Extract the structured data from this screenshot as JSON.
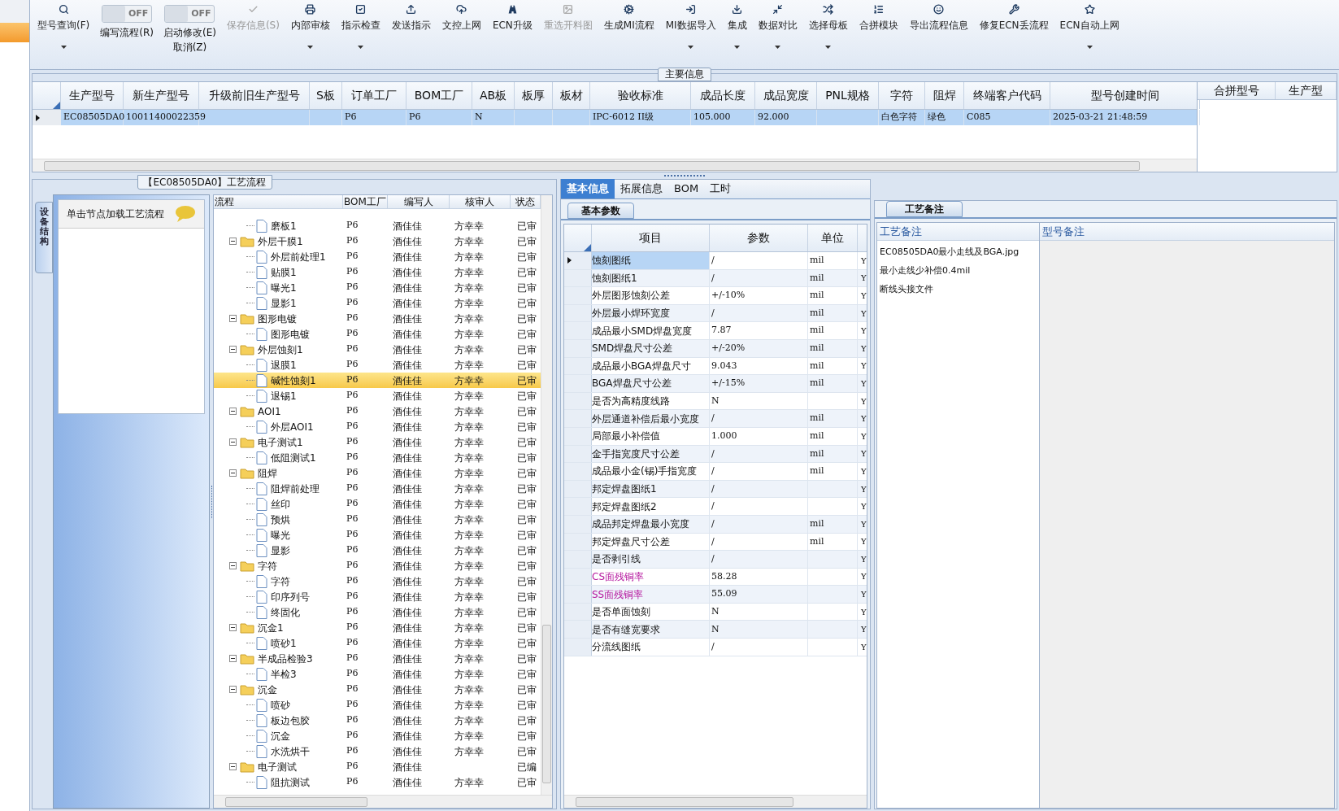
{
  "toolbar": [
    {
      "kind": "button",
      "label": "型号查询(F)",
      "dropdown": true,
      "disabled": false
    },
    {
      "kind": "toggle",
      "label": "编写流程(R)",
      "switch_text": "OFF",
      "on": false
    },
    {
      "kind": "toggle",
      "label": "启动修改(E)",
      "label2": "取消(Z)",
      "switch_text": "OFF",
      "on": false
    },
    {
      "kind": "button",
      "label": "保存信息(S)",
      "dropdown": false,
      "disabled": true
    },
    {
      "kind": "button",
      "label": "内部审核",
      "dropdown": true,
      "disabled": false
    },
    {
      "kind": "button",
      "label": "指示检查",
      "dropdown": true,
      "disabled": false
    },
    {
      "kind": "button",
      "label": "发送指示",
      "dropdown": false,
      "disabled": false
    },
    {
      "kind": "button",
      "label": "文控上网",
      "dropdown": false,
      "disabled": false
    },
    {
      "kind": "button",
      "label": "ECN升级",
      "dropdown": false,
      "disabled": false
    },
    {
      "kind": "button",
      "label": "重选开料图",
      "dropdown": false,
      "disabled": true
    },
    {
      "kind": "button",
      "label": "生成MI流程",
      "dropdown": false,
      "disabled": false
    },
    {
      "kind": "button",
      "label": "MI数据导入",
      "dropdown": true,
      "disabled": false
    },
    {
      "kind": "button",
      "label": "集成",
      "dropdown": true,
      "disabled": false
    },
    {
      "kind": "button",
      "label": "数据对比",
      "dropdown": true,
      "disabled": false
    },
    {
      "kind": "button",
      "label": "选择母板",
      "dropdown": true,
      "disabled": false
    },
    {
      "kind": "button",
      "label": "合拼模块",
      "dropdown": false,
      "disabled": false
    },
    {
      "kind": "button",
      "label": "导出流程信息",
      "dropdown": false,
      "disabled": false
    },
    {
      "kind": "button",
      "label": "修复ECN丢流程",
      "dropdown": false,
      "disabled": false
    },
    {
      "kind": "button",
      "label": "ECN自动上网",
      "dropdown": true,
      "disabled": false
    }
  ],
  "main_info": {
    "title": "主要信息",
    "table": {
      "columns": [
        "生产型号",
        "新生产型号",
        "升级前旧生产型号",
        "S板",
        "订单工厂",
        "BOM工厂",
        "AB板",
        "板厚",
        "板材",
        "验收标准",
        "成品长度",
        "成品宽度",
        "PNL规格",
        "字符",
        "阻焊",
        "终端客户代码",
        "型号创建时间"
      ],
      "rows": [
        {
          "selected": true,
          "cells": [
            "EC08505DA0",
            "10011400022359",
            null,
            null,
            "P6",
            "P6",
            "N",
            null,
            null,
            "IPC-6012 II级",
            "105.000",
            "92.000",
            null,
            "白色字符",
            "绿色",
            "C085",
            "2025-03-21 21:48:59"
          ]
        }
      ]
    },
    "merge_table": {
      "columns": [
        "合拼型号",
        "生产型"
      ]
    }
  },
  "process_panel": {
    "title": "【EC08505DA0】工艺流程",
    "side_tab": "设备结构",
    "hint": "单击节点加载工艺流程",
    "tree": {
      "columns": [
        "流程",
        "BOM工厂",
        "编写人",
        "核审人",
        "状态"
      ],
      "nodes": [
        {
          "kind": "file",
          "label": "磨板1",
          "bom": "P6",
          "writer": "酒佳佳",
          "reviewer": "方幸幸",
          "status": "已审",
          "selected": false
        },
        {
          "kind": "folder",
          "label": "外层干膜1",
          "bom": "P6",
          "writer": "酒佳佳",
          "reviewer": "方幸幸",
          "status": "已审",
          "selected": false,
          "expanded": true,
          "children": [
            {
              "kind": "file",
              "label": "外层前处理1",
              "bom": "P6",
              "writer": "酒佳佳",
              "reviewer": "方幸幸",
              "status": "已审",
              "selected": false
            },
            {
              "kind": "file",
              "label": "贴膜1",
              "bom": "P6",
              "writer": "酒佳佳",
              "reviewer": "方幸幸",
              "status": "已审",
              "selected": false
            },
            {
              "kind": "file",
              "label": "曝光1",
              "bom": "P6",
              "writer": "酒佳佳",
              "reviewer": "方幸幸",
              "status": "已审",
              "selected": false
            },
            {
              "kind": "file",
              "label": "显影1",
              "bom": "P6",
              "writer": "酒佳佳",
              "reviewer": "方幸幸",
              "status": "已审",
              "selected": false
            }
          ]
        },
        {
          "kind": "folder",
          "label": "图形电镀",
          "bom": "P6",
          "writer": "酒佳佳",
          "reviewer": "方幸幸",
          "status": "已审",
          "selected": false,
          "expanded": true,
          "children": [
            {
              "kind": "file",
              "label": "图形电镀",
              "bom": "P6",
              "writer": "酒佳佳",
              "reviewer": "方幸幸",
              "status": "已审",
              "selected": false
            }
          ]
        },
        {
          "kind": "folder",
          "label": "外层蚀刻1",
          "bom": "P6",
          "writer": "酒佳佳",
          "reviewer": "方幸幸",
          "status": "已审",
          "selected": false,
          "expanded": true,
          "children": [
            {
              "kind": "file",
              "label": "退膜1",
              "bom": "P6",
              "writer": "酒佳佳",
              "reviewer": "方幸幸",
              "status": "已审",
              "selected": false
            },
            {
              "kind": "file",
              "label": "碱性蚀刻1",
              "bom": "P6",
              "writer": "酒佳佳",
              "reviewer": "方幸幸",
              "status": "已审",
              "selected": true
            },
            {
              "kind": "file",
              "label": "退锡1",
              "bom": "P6",
              "writer": "酒佳佳",
              "reviewer": "方幸幸",
              "status": "已审",
              "selected": false
            }
          ]
        },
        {
          "kind": "folder",
          "label": "AOI1",
          "bom": "P6",
          "writer": "酒佳佳",
          "reviewer": "方幸幸",
          "status": "已审",
          "selected": false,
          "expanded": true,
          "children": [
            {
              "kind": "file",
              "label": "外层AOI1",
              "bom": "P6",
              "writer": "酒佳佳",
              "reviewer": "方幸幸",
              "status": "已审",
              "selected": false
            }
          ]
        },
        {
          "kind": "folder",
          "label": "电子测试1",
          "bom": "P6",
          "writer": "酒佳佳",
          "reviewer": "方幸幸",
          "status": "已审",
          "selected": false,
          "expanded": true,
          "children": [
            {
              "kind": "file",
              "label": "低阻测试1",
              "bom": "P6",
              "writer": "酒佳佳",
              "reviewer": "方幸幸",
              "status": "已审",
              "selected": false
            }
          ]
        },
        {
          "kind": "folder",
          "label": "阻焊",
          "bom": "P6",
          "writer": "酒佳佳",
          "reviewer": "方幸幸",
          "status": "已审",
          "selected": false,
          "expanded": true,
          "children": [
            {
              "kind": "file",
              "label": "阻焊前处理",
              "bom": "P6",
              "writer": "酒佳佳",
              "reviewer": "方幸幸",
              "status": "已审",
              "selected": false
            },
            {
              "kind": "file",
              "label": "丝印",
              "bom": "P6",
              "writer": "酒佳佳",
              "reviewer": "方幸幸",
              "status": "已审",
              "selected": false
            },
            {
              "kind": "file",
              "label": "预烘",
              "bom": "P6",
              "writer": "酒佳佳",
              "reviewer": "方幸幸",
              "status": "已审",
              "selected": false
            },
            {
              "kind": "file",
              "label": "曝光",
              "bom": "P6",
              "writer": "酒佳佳",
              "reviewer": "方幸幸",
              "status": "已审",
              "selected": false
            },
            {
              "kind": "file",
              "label": "显影",
              "bom": "P6",
              "writer": "酒佳佳",
              "reviewer": "方幸幸",
              "status": "已审",
              "selected": false
            }
          ]
        },
        {
          "kind": "folder",
          "label": "字符",
          "bom": "P6",
          "writer": "酒佳佳",
          "reviewer": "方幸幸",
          "status": "已审",
          "selected": false,
          "expanded": true,
          "children": [
            {
              "kind": "file",
              "label": "字符",
              "bom": "P6",
              "writer": "酒佳佳",
              "reviewer": "方幸幸",
              "status": "已审",
              "selected": false
            },
            {
              "kind": "file",
              "label": "印序列号",
              "bom": "P6",
              "writer": "酒佳佳",
              "reviewer": "方幸幸",
              "status": "已审",
              "selected": false
            },
            {
              "kind": "file",
              "label": "终固化",
              "bom": "P6",
              "writer": "酒佳佳",
              "reviewer": "方幸幸",
              "status": "已审",
              "selected": false
            }
          ]
        },
        {
          "kind": "folder",
          "label": "沉金1",
          "bom": "P6",
          "writer": "酒佳佳",
          "reviewer": "方幸幸",
          "status": "已审",
          "selected": false,
          "expanded": true,
          "children": [
            {
              "kind": "file",
              "label": "喷砂1",
              "bom": "P6",
              "writer": "酒佳佳",
              "reviewer": "方幸幸",
              "status": "已审",
              "selected": false
            }
          ]
        },
        {
          "kind": "folder",
          "label": "半成品检验3",
          "bom": "P6",
          "writer": "酒佳佳",
          "reviewer": "方幸幸",
          "status": "已审",
          "selected": false,
          "expanded": true,
          "children": [
            {
              "kind": "file",
              "label": "半检3",
              "bom": "P6",
              "writer": "酒佳佳",
              "reviewer": "方幸幸",
              "status": "已审",
              "selected": false
            }
          ]
        },
        {
          "kind": "folder",
          "label": "沉金",
          "bom": "P6",
          "writer": "酒佳佳",
          "reviewer": "方幸幸",
          "status": "已审",
          "selected": false,
          "expanded": true,
          "children": [
            {
              "kind": "file",
              "label": "喷砂",
              "bom": "P6",
              "writer": "酒佳佳",
              "reviewer": "方幸幸",
              "status": "已审",
              "selected": false
            },
            {
              "kind": "file",
              "label": "板边包胶",
              "bom": "P6",
              "writer": "酒佳佳",
              "reviewer": "方幸幸",
              "status": "已审",
              "selected": false
            },
            {
              "kind": "file",
              "label": "沉金",
              "bom": "P6",
              "writer": "酒佳佳",
              "reviewer": "方幸幸",
              "status": "已审",
              "selected": false
            },
            {
              "kind": "file",
              "label": "水洗烘干",
              "bom": "P6",
              "writer": "酒佳佳",
              "reviewer": "方幸幸",
              "status": "已审",
              "selected": false
            }
          ]
        },
        {
          "kind": "folder",
          "label": "电子测试",
          "bom": "P6",
          "writer": "酒佳佳",
          "status": "已编",
          "selected": false,
          "expanded": true,
          "children": [
            {
              "kind": "file",
              "label": "阻抗测试",
              "bom": "P6",
              "writer": "酒佳佳",
              "reviewer": "方幸幸",
              "status": "已审",
              "selected": false
            }
          ]
        }
      ]
    }
  },
  "detail_panel": {
    "tabs": [
      {
        "label": "基本信息",
        "selected": true
      },
      {
        "label": "拓展信息",
        "selected": false
      },
      {
        "label": "BOM",
        "selected": false
      },
      {
        "label": "工时",
        "selected": false
      }
    ],
    "subtab": "基本参数",
    "table": {
      "columns": [
        "项目",
        "参数",
        "单位"
      ],
      "rows": [
        {
          "item": "蚀刻图纸",
          "param": "/",
          "unit": "mil",
          "flag": "Y",
          "selected": true
        },
        {
          "item": "蚀刻图纸1",
          "param": "/",
          "unit": "mil",
          "flag": "Y",
          "selected": false
        },
        {
          "item": "外层图形蚀刻公差",
          "param": "+/-10%",
          "unit": "mil",
          "flag": "Y",
          "selected": false
        },
        {
          "item": "外层最小焊环宽度",
          "param": "/",
          "unit": "mil",
          "flag": "Y",
          "selected": false
        },
        {
          "item": "成品最小SMD焊盘宽度",
          "param": "7.87",
          "unit": "mil",
          "flag": "Y",
          "selected": false
        },
        {
          "item": "SMD焊盘尺寸公差",
          "param": "+/-20%",
          "unit": "mil",
          "flag": "Y",
          "selected": false
        },
        {
          "item": "成品最小BGA焊盘尺寸",
          "param": "9.043",
          "unit": "mil",
          "flag": "Y",
          "selected": false
        },
        {
          "item": "BGA焊盘尺寸公差",
          "param": "+/-15%",
          "unit": "mil",
          "flag": "Y",
          "selected": false
        },
        {
          "item": "是否为高精度线路",
          "param": "N",
          "flag": "Y",
          "selected": false
        },
        {
          "item": "外层通道补偿后最小宽度",
          "param": "/",
          "unit": "mil",
          "flag": "Y",
          "selected": false
        },
        {
          "item": "局部最小补偿值",
          "param": "1.000",
          "unit": "mil",
          "flag": "Y",
          "selected": false
        },
        {
          "item": "金手指宽度尺寸公差",
          "param": "/",
          "unit": "mil",
          "flag": "Y",
          "selected": false
        },
        {
          "item": "成品最小金(锡)手指宽度",
          "param": "/",
          "unit": "mil",
          "flag": "Y",
          "selected": false
        },
        {
          "item": "邦定焊盘图纸1",
          "param": "/",
          "flag": "Y",
          "selected": false
        },
        {
          "item": "邦定焊盘图纸2",
          "param": "/",
          "flag": "Y",
          "selected": false
        },
        {
          "item": "成品邦定焊盘最小宽度",
          "param": "/",
          "unit": "mil",
          "flag": "Y",
          "selected": false
        },
        {
          "item": "邦定焊盘尺寸公差",
          "param": "/",
          "unit": "mil",
          "flag": "Y",
          "selected": false
        },
        {
          "item": "是否剥引线",
          "param": "/",
          "flag": "Y",
          "selected": false
        },
        {
          "item": "CS面残铜率",
          "param": "58.28",
          "flag": "Y",
          "selected": false,
          "color": "#b5179e"
        },
        {
          "item": "SS面残铜率",
          "param": "55.09",
          "flag": "Y",
          "selected": false,
          "color": "#b5179e"
        },
        {
          "item": "是否单面蚀刻",
          "param": "N",
          "flag": "Y",
          "selected": false
        },
        {
          "item": "是否有缝宽要求",
          "param": "N",
          "flag": "Y",
          "selected": false
        },
        {
          "item": "分流线图纸",
          "param": "/",
          "flag": "Y",
          "selected": false
        }
      ]
    }
  },
  "notes_panel": {
    "tab": "工艺备注",
    "columns": [
      "工艺备注",
      "型号备注"
    ],
    "notes": [
      "EC08505DA0最小走线及BGA.jpg",
      "最小走线少补偿0.4mil",
      "断线头接文件"
    ]
  }
}
